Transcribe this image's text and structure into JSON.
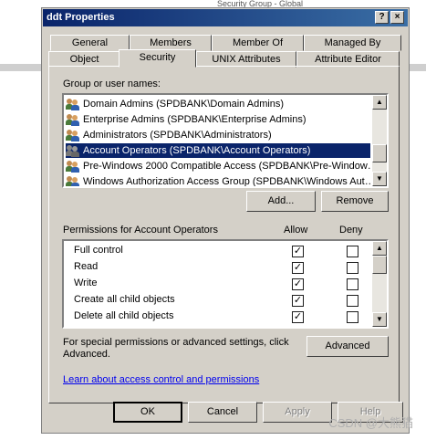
{
  "background_fragment": "Security Group - Global",
  "window": {
    "title": "ddt Properties",
    "help": "?",
    "close": "×"
  },
  "tabs_row1": [
    "General",
    "Members",
    "Member Of",
    "Managed By"
  ],
  "tabs_row2": [
    "Object",
    "Security",
    "UNIX Attributes",
    "Attribute Editor"
  ],
  "groups_label": "Group or user names:",
  "groups": [
    "Domain Admins (SPDBANK\\Domain Admins)",
    "Enterprise Admins (SPDBANK\\Enterprise Admins)",
    "Administrators (SPDBANK\\Administrators)",
    "Account Operators (SPDBANK\\Account Operators)",
    "Pre-Windows 2000 Compatible Access (SPDBANK\\Pre-Window…",
    "Windows Authorization Access Group (SPDBANK\\Windows Aut…"
  ],
  "buttons": {
    "add": "Add...",
    "remove": "Remove",
    "advanced": "Advanced",
    "ok": "OK",
    "cancel": "Cancel",
    "apply": "Apply",
    "help": "Help"
  },
  "permissions": {
    "label": "Permissions for Account Operators",
    "allow_header": "Allow",
    "deny_header": "Deny",
    "items": [
      {
        "name": "Full control",
        "allow": "✓",
        "deny": ""
      },
      {
        "name": "Read",
        "allow": "✓",
        "deny": ""
      },
      {
        "name": "Write",
        "allow": "✓",
        "deny": ""
      },
      {
        "name": "Create all child objects",
        "allow": "✓",
        "deny": ""
      },
      {
        "name": "Delete all child objects",
        "allow": "✓",
        "deny": ""
      }
    ]
  },
  "special_text": "For special permissions or advanced settings, click Advanced.",
  "learn_link": "Learn about access control and permissions",
  "watermark": "CSDN @大熊猫"
}
